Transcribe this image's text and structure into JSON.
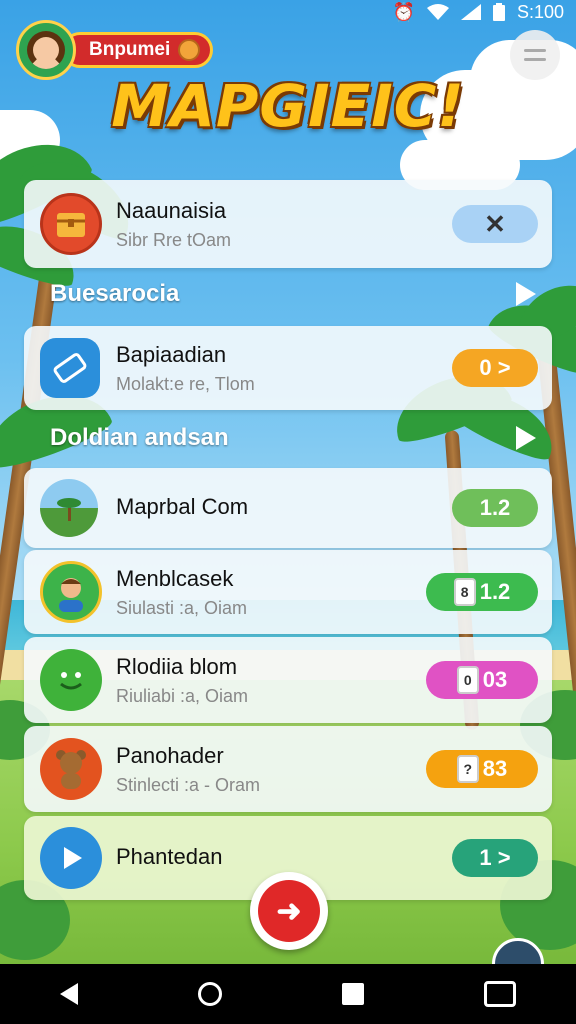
{
  "status_bar": {
    "time": "S:100"
  },
  "header": {
    "profile_name": "Bnpumei",
    "logo": "MAPGIEIC!"
  },
  "cards": [
    {
      "title": "Naaunaisia",
      "subtitle": "Sibr Rre tOam",
      "pill": "",
      "pill_color": "#a9d2f5"
    },
    {
      "title": "Bapiaadian",
      "subtitle": "Molakt:e re, Tlom",
      "pill": "0 >",
      "pill_color": "#f5a623"
    },
    {
      "title": "Maprbal Com",
      "subtitle": "",
      "pill": "1.2",
      "pill_color": "#6fbf5a"
    },
    {
      "title": "Menblcasek",
      "subtitle": "Siulasti :a, Oiam",
      "pill": "1.2",
      "pill_color": "#3dbb4f",
      "badge": "8"
    },
    {
      "title": "Rlodiia blom",
      "subtitle": "Riuliabi :a, Oiam",
      "pill": "03",
      "pill_color": "#e052c4",
      "badge": "0"
    },
    {
      "title": "Panohader",
      "subtitle": "Stinlecti :a - Oram",
      "pill": "83",
      "pill_color": "#f5a20f",
      "badge": "?"
    },
    {
      "title": "Phantedan",
      "subtitle": "",
      "pill": "1 >",
      "pill_color": "#27a37a"
    }
  ],
  "sections": [
    {
      "label": "Buesarocia"
    },
    {
      "label": "Doldian andsan"
    }
  ]
}
